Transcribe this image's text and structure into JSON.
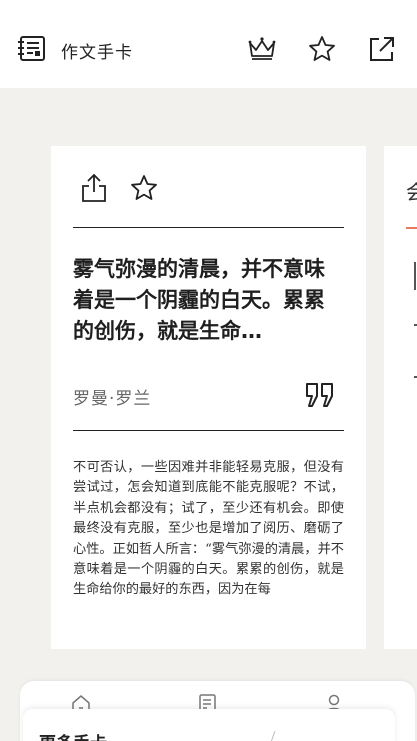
{
  "header": {
    "app_icon": "notebook-icon",
    "title": "作文手卡",
    "actions": [
      {
        "name": "crown-icon"
      },
      {
        "name": "star-icon"
      },
      {
        "name": "share-icon"
      }
    ]
  },
  "card": {
    "actions": [
      {
        "name": "share-icon"
      },
      {
        "name": "star-icon"
      }
    ],
    "headline": "雾气弥漫的清晨，并不意味着是一个阴霾的白天。累累的创伤，就是生命…",
    "author": "罗曼·罗兰",
    "quote_icon": "quote-icon",
    "body": "不可否认，一些因难并非能轻易克服，但没有尝试过，怎会知道到底能不能克服呢？不试，半点机会都没有；试了，至少还有机会。即使最终没有克服，至少也是增加了阅历、磨砺了心性。正如哲人所言：“雾气弥漫的清晨，并不意味着是一个阴霾的白天。累累的创伤，就是生命给你的最好的东西，因为在每"
  },
  "next_card": {
    "partial_char": "会",
    "accent_color": "#e57a5c"
  },
  "bottom_nav": {
    "items": [
      {
        "icon": "home-icon"
      },
      {
        "icon": "document-icon"
      },
      {
        "icon": "user-icon"
      }
    ]
  },
  "more_sheet": {
    "title": "更多手卡"
  }
}
